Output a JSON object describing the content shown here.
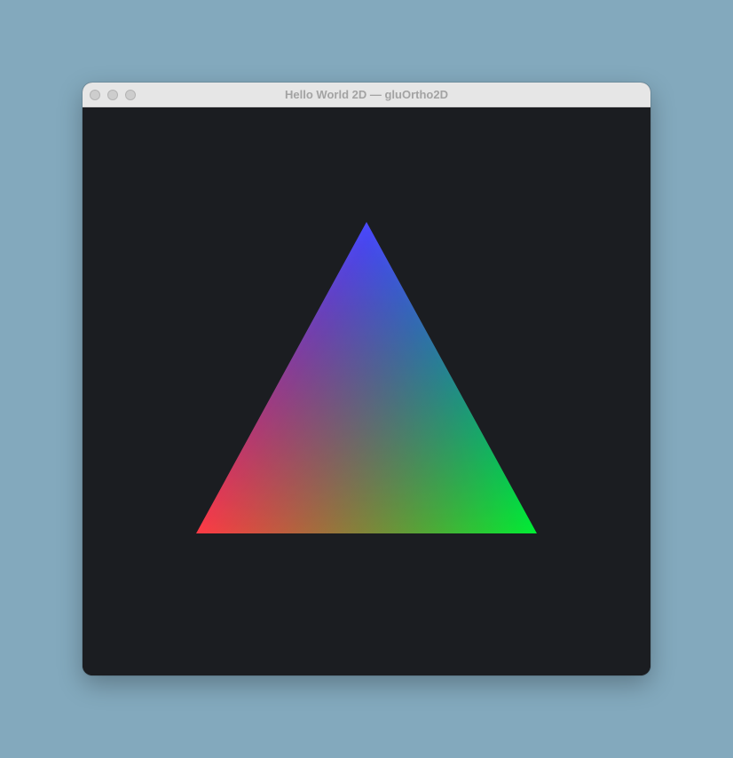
{
  "window": {
    "title": "Hello World 2D — gluOrtho2D"
  },
  "scene": {
    "background_color": "#1b1d21",
    "primitive": "triangle",
    "vertex_colors": {
      "top": "#4b4bff",
      "bottom_left": "#ff3a45",
      "bottom_right": "#00ee33"
    }
  },
  "icons": {
    "close": "close-icon",
    "minimize": "minimize-icon",
    "zoom": "zoom-icon"
  }
}
